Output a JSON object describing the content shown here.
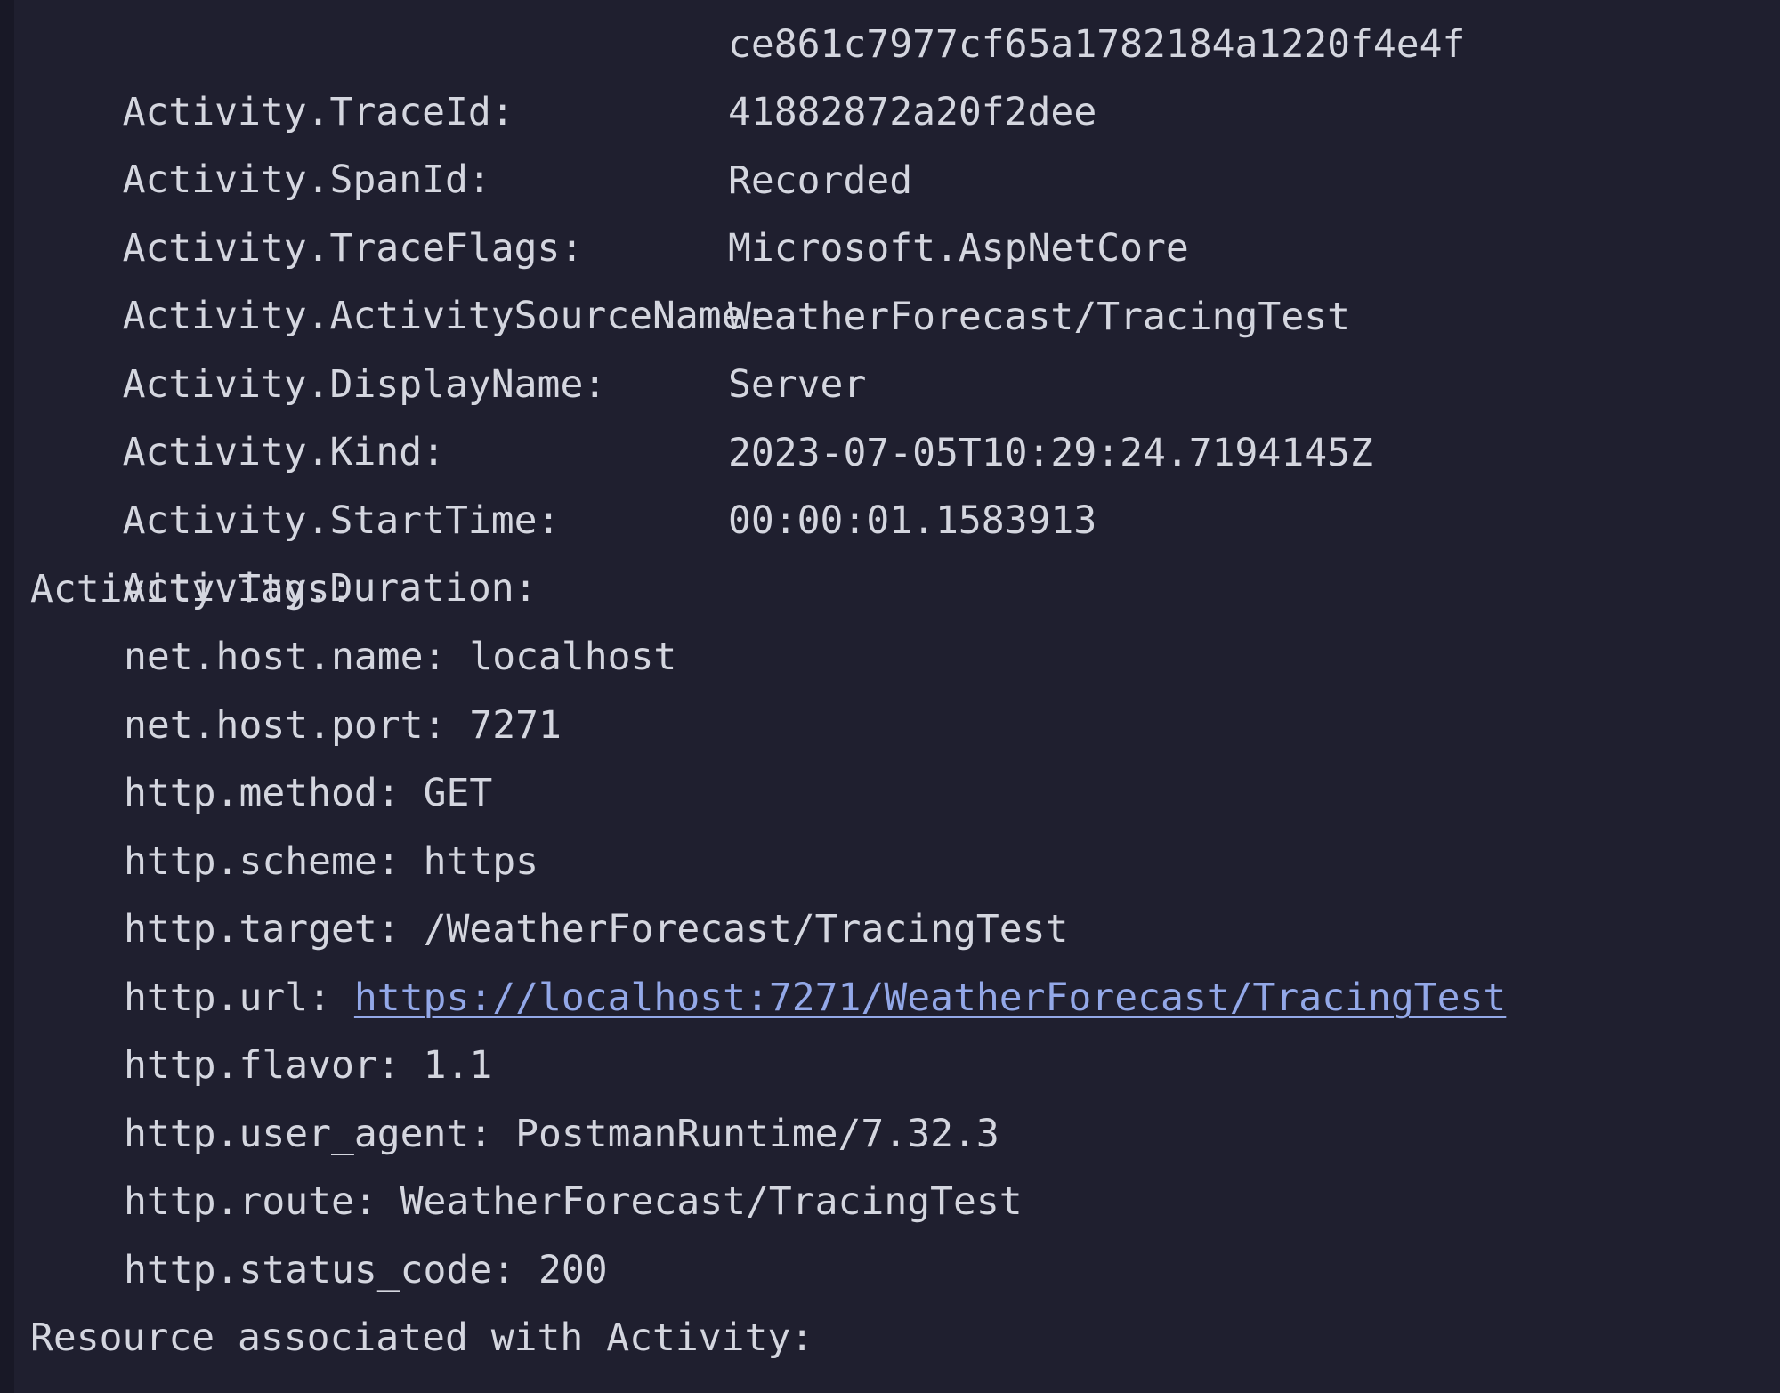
{
  "fields": [
    {
      "key": "Activity.TraceId:",
      "value": "ce861c7977cf65a1782184a1220f4e4f"
    },
    {
      "key": "Activity.SpanId:",
      "value": "41882872a20f2dee"
    },
    {
      "key": "Activity.TraceFlags:",
      "value": "Recorded"
    },
    {
      "key": "Activity.ActivitySourceName:",
      "value": "Microsoft.AspNetCore"
    },
    {
      "key": "Activity.DisplayName:",
      "value": "WeatherForecast/TracingTest"
    },
    {
      "key": "Activity.Kind:",
      "value": "Server"
    },
    {
      "key": "Activity.StartTime:",
      "value": "2023-07-05T10:29:24.7194145Z"
    },
    {
      "key": "Activity.Duration:",
      "value": "00:00:01.1583913"
    }
  ],
  "tags_header": "Activity.Tags:",
  "tags": [
    {
      "key": "net.host.name:",
      "value": "localhost"
    },
    {
      "key": "net.host.port:",
      "value": "7271"
    },
    {
      "key": "http.method:",
      "value": "GET"
    },
    {
      "key": "http.scheme:",
      "value": "https"
    },
    {
      "key": "http.target:",
      "value": "/WeatherForecast/TracingTest"
    },
    {
      "key": "http.url:",
      "value": "https://localhost:7271/WeatherForecast/TracingTest"
    },
    {
      "key": "http.flavor:",
      "value": "1.1"
    },
    {
      "key": "http.user_agent:",
      "value": "PostmanRuntime/7.32.3"
    },
    {
      "key": "http.route:",
      "value": "WeatherForecast/TracingTest"
    },
    {
      "key": "http.status_code:",
      "value": "200"
    }
  ],
  "footer": "Resource associated with Activity:",
  "colors": {
    "background": "#1f1f2f",
    "text": "#d4d6df",
    "link": "#93a8e8"
  }
}
